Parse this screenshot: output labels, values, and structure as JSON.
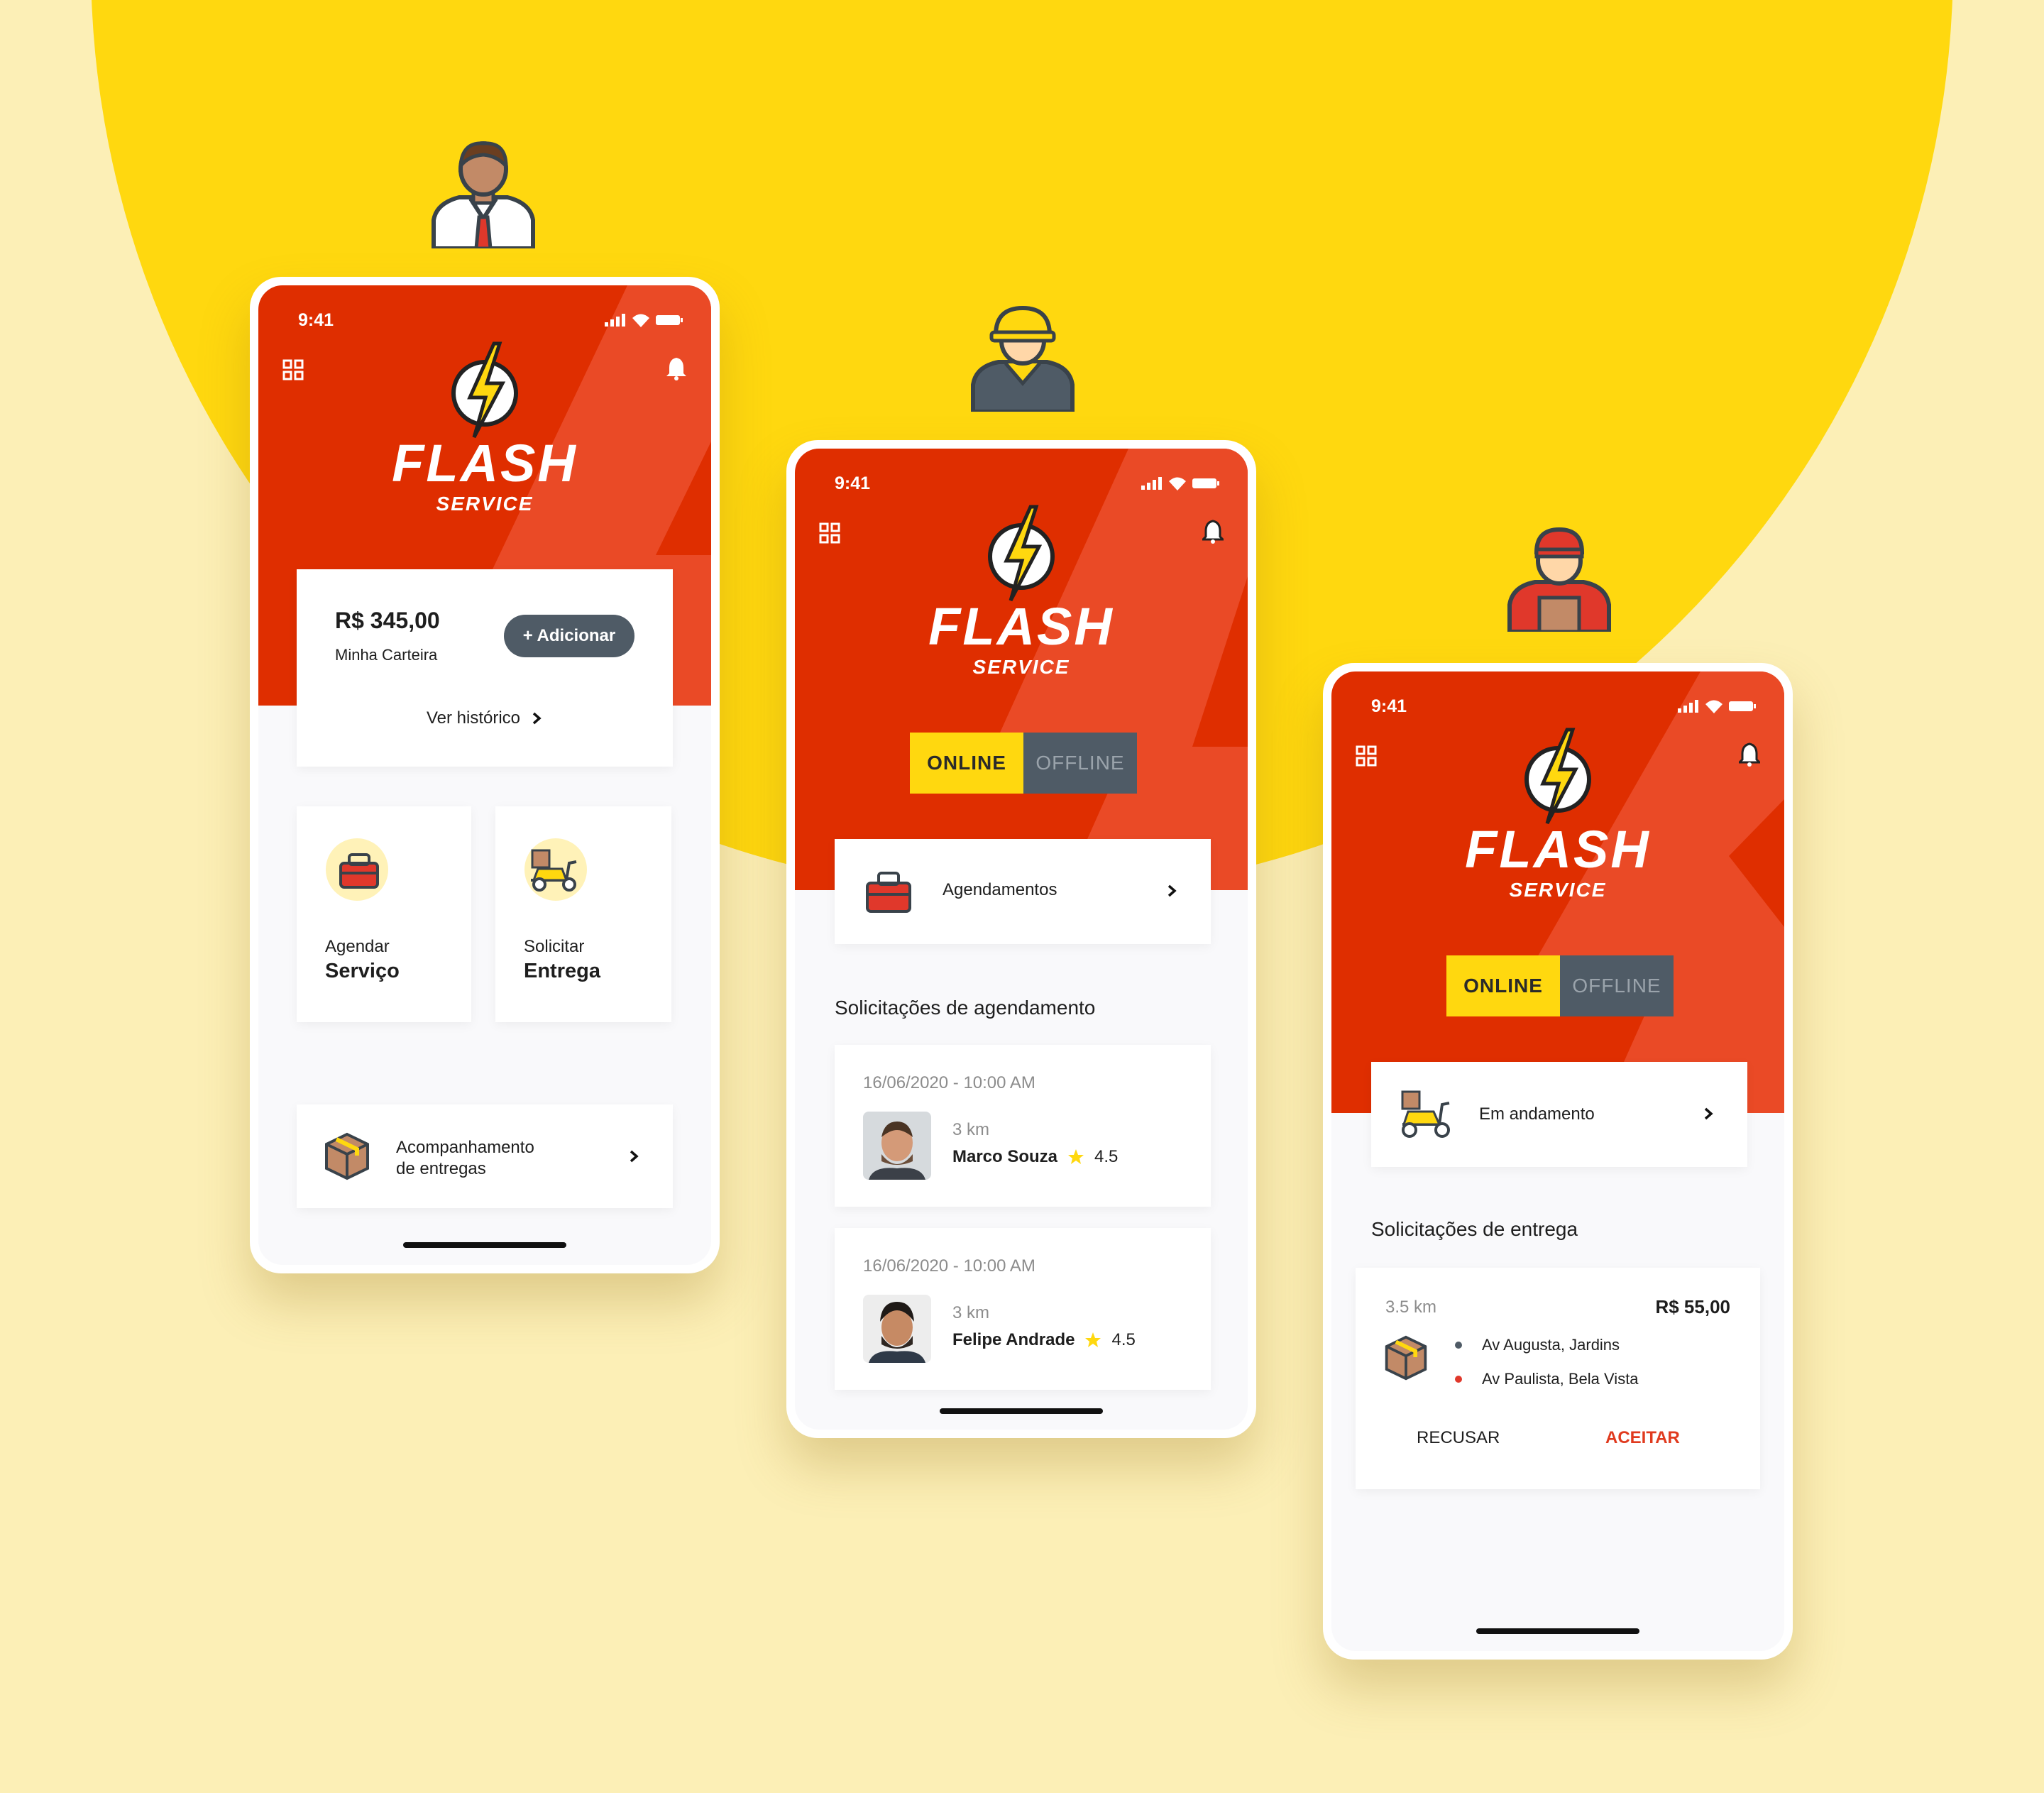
{
  "status_time": "9:41",
  "brand": {
    "name": "FLASH",
    "sub": "SERVICE"
  },
  "phone1": {
    "wallet": {
      "amount": "R$ 345,00",
      "label": "Minha Carteira",
      "add_button": "+ Adicionar",
      "history_link": "Ver histórico"
    },
    "tiles": [
      {
        "top": "Agendar",
        "bottom": "Serviço",
        "icon": "toolbox-icon"
      },
      {
        "top": "Solicitar",
        "bottom": "Entrega",
        "icon": "scooter-icon"
      }
    ],
    "tracking": {
      "line1": "Acompanhamento",
      "line2": "de entregas",
      "icon": "package-icon"
    }
  },
  "phone2": {
    "toggle": {
      "online": "ONLINE",
      "offline": "OFFLINE"
    },
    "schedules_card": {
      "label": "Agendamentos",
      "icon": "toolbox-icon"
    },
    "section_title": "Solicitações de agendamento",
    "requests": [
      {
        "date": "16/06/2020 - 10:00 AM",
        "distance": "3 km",
        "name": "Marco Souza",
        "rating": "4.5"
      },
      {
        "date": "16/06/2020 - 10:00 AM",
        "distance": "3 km",
        "name": "Felipe Andrade",
        "rating": "4.5"
      }
    ]
  },
  "phone3": {
    "toggle": {
      "online": "ONLINE",
      "offline": "OFFLINE"
    },
    "progress_card": {
      "label": "Em andamento",
      "icon": "scooter-icon"
    },
    "section_title": "Solicitações de entrega",
    "delivery": {
      "distance": "3.5 km",
      "price": "R$ 55,00",
      "from": "Av Augusta, Jardins",
      "to": "Av Paulista, Bela Vista",
      "reject": "RECUSAR",
      "accept": "ACEITAR"
    }
  },
  "colors": {
    "brand_red": "#DF2E00",
    "brand_yellow": "#FFD80F",
    "slate": "#4F5B66",
    "accept_red": "#E03A1E"
  }
}
